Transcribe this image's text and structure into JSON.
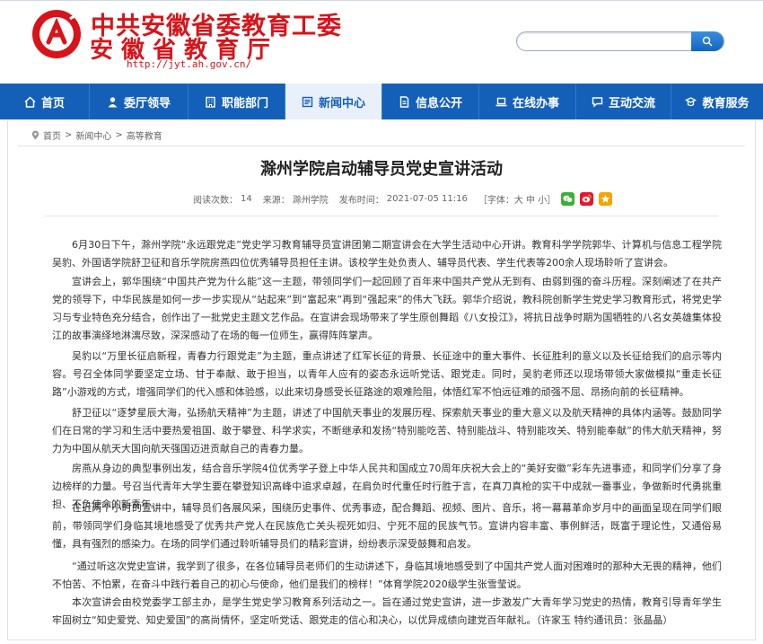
{
  "site": {
    "title_line1": "中共安徽省委教育工委",
    "title_line2": "安徽省教育厅",
    "url": "http://jyt.ah.gov.cn/",
    "search_placeholder": ""
  },
  "nav": {
    "items": [
      {
        "label": "首页",
        "icon": "home-icon"
      },
      {
        "label": "委厅领导",
        "icon": "user-icon"
      },
      {
        "label": "职能部门",
        "icon": "building-icon"
      },
      {
        "label": "新闻中心",
        "icon": "news-icon"
      },
      {
        "label": "信息公开",
        "icon": "document-icon"
      },
      {
        "label": "在线办事",
        "icon": "laptop-icon"
      },
      {
        "label": "互动交流",
        "icon": "chat-icon"
      },
      {
        "label": "教育服务",
        "icon": "service-icon"
      }
    ],
    "active_index": 3
  },
  "breadcrumb": {
    "items": [
      "首页",
      "新闻中心",
      "高等教育"
    ],
    "separator": ">"
  },
  "article": {
    "title": "滁州学院启动辅导员党史宣讲活动",
    "meta": {
      "views_label": "阅读次数：",
      "views": "14",
      "source_label": "来源：",
      "source": "滁州学院",
      "time_label": "发布时间：",
      "time": "2021-07-05 11:16",
      "font_size": "［字体：大 中 小］"
    },
    "paragraphs": [
      "6月30日下午，滁州学院“永远跟党走”党史学习教育辅导员宣讲团第二期宣讲会在大学生活动中心开讲。教育科学学院郭华、计算机与信息工程学院吴豹、外国语学院舒卫征和音乐学院房燕四位优秀辅导员担任主讲。该校学生处负责人、辅导员代表、学生代表等200余人现场聆听了宣讲会。",
      "宣讲会上，郭华围绕“中国共产党为什么能”这一主题，带领同学们一起回顾了百年来中国共产党从无到有、由弱到强的奋斗历程。深刻阐述了在共产党的领导下，中华民族是如何一步一步实现从“站起来”到“富起来”再到“强起来”的伟大飞跃。郭华介绍说，教科院创新学生党史学习教育形式，将党史学习与专业特色充分结合，创作出了一批党史主题文艺作品。在宣讲会现场带来了学生原创舞蹈《八女投江》，将抗日战争时期为国牺牲的八名女英雄集体投江的故事演绎地淋漓尽致，深深感动了在场的每一位师生，赢得阵阵掌声。",
      "吴豹以“万里长征启新程，青春力行跟党走”为主题，重点讲述了红军长征的背景、长征途中的重大事件、长征胜利的意义以及长征给我们的启示等内容。号召全体同学要坚定立场、甘于奉献、敢于担当，以青年人应有的姿态永远听党话、跟党走。同时，吴豹老师还以现场带领大家做模拟“重走长征路”小游戏的方式，增强同学们的代入感和体验感，以此来切身感受长征路途的艰难险阻，体悟红军不怕远征难的顽强不屈、昂扬向前的长征精神。",
      "舒卫征以“逐梦星辰大海，弘扬航天精神”为主题，讲述了中国航天事业的发展历程、探索航天事业的重大意义以及航天精神的具体内涵等。鼓励同学们在日常的学习和生活中要热爱祖国、敢于攀登、科学求实，不断继承和发扬“特别能吃苦、特别能战斗、特别能攻关、特别能奉献”的伟大航天精神，努力为中国从航天大国向航天强国迈进贡献自己的青春力量。",
      "房燕从身边的典型事例出发，结合音乐学院4位优秀学子登上中华人民共和国成立70周年庆祝大会上的“美好安徽”彩车先进事迹，和同学们分享了身边榜样的力量。号召当代青年大学生要在攀登知识高峰中追求卓越，在肩负时代重任时行胜于言，在真刀真枪的实干中成就一番事业，争做新时代勇挑重担、不负使命的新青年。",
      "在近两个小时的宣讲中，辅导员们各展风采，围绕历史事件、优秀事迹，配合舞蹈、视频、图片、音乐，将一幕幕革命岁月中的画面呈现在同学们眼前，带领同学们身临其境地感受了优秀共产党人在民族危亡关头视死如归、宁死不屈的民族气节。宣讲内容丰富、事例鲜活，既富于理论性，又通俗易懂，具有强烈的感染力。在场的同学们通过聆听辅导员们的精彩宣讲，纷纷表示深受鼓舞和启发。",
      "“通过听这次党史宣讲，我学到了很多，在各位辅导员老师们的生动讲述下，身临其境地感受到了中国共产党人面对困难时的那种大无畏的精神，他们不怕苦、不怕累，在奋斗中践行着自己的初心与使命，他们是我们的榜样！”体育学院2020级学生张雪莹说。",
      "本次宣讲会由校党委学工部主办，是学生党史学习教育系列活动之一。旨在通过党史宣讲，进一步激发广大青年学习党史的热情，教育引导青年学生牢固树立“知史爱党、知史爱国”的高尚情怀，坚定听党话、跟党走的信心和决心，以优异成绩向建党百年献礼。（许家玉 特约通讯员：张晶晶）"
    ]
  },
  "colors": {
    "brand_red": "#d7141a",
    "nav_blue": "#1460b9",
    "wechat_green": "#3cb034",
    "weibo_orange": "#e6162d",
    "qzone_yellow": "#f5a400"
  }
}
